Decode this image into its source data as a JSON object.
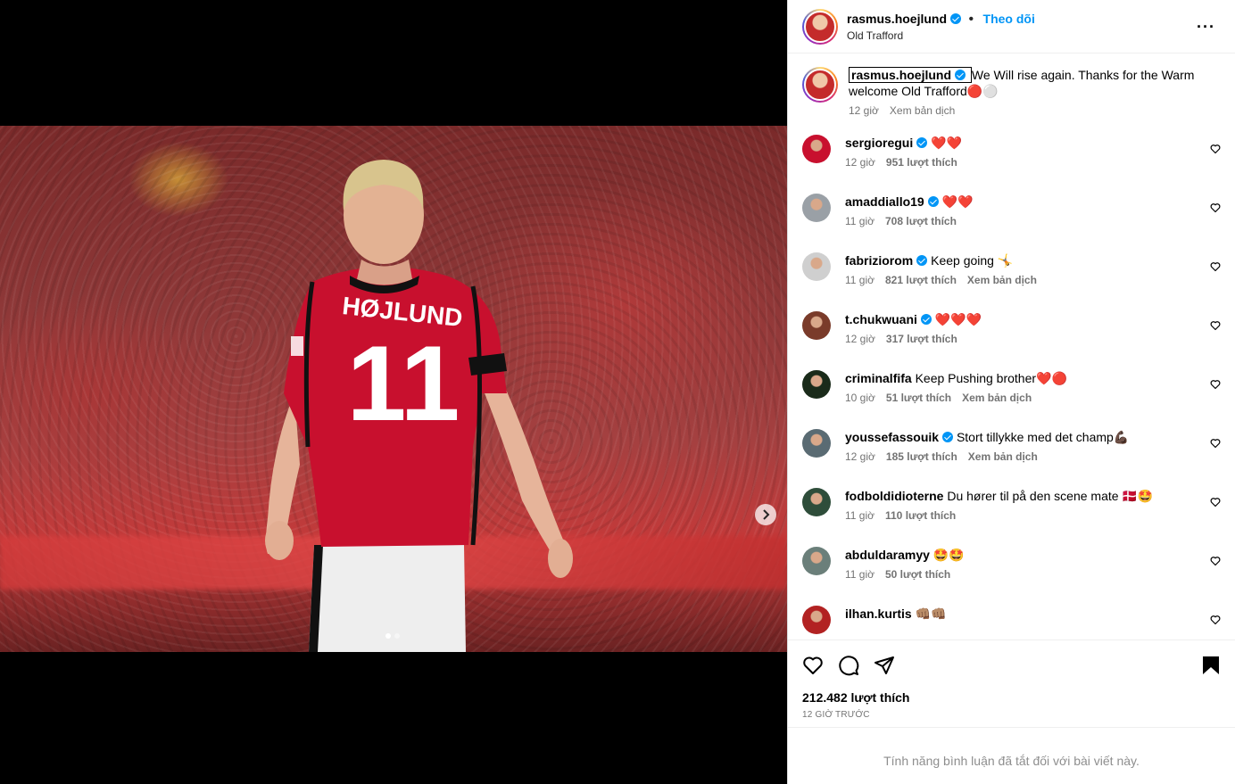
{
  "post": {
    "username": "rasmus.hoejlund",
    "follow_label": "Theo dõi",
    "location": "Old Trafford",
    "more_label": "···",
    "caption_text": "We Will rise again. Thanks for the Warm welcome Old Trafford🔴⚪",
    "caption_time": "12 giờ",
    "caption_translate": "Xem bản dịch"
  },
  "comments": [
    {
      "user": "sergioregui",
      "verified": true,
      "text": "❤️❤️",
      "time": "12 giờ",
      "likes": "951 lượt thích",
      "translate": ""
    },
    {
      "user": "amaddiallo19",
      "verified": true,
      "text": "❤️❤️",
      "time": "11 giờ",
      "likes": "708 lượt thích",
      "translate": ""
    },
    {
      "user": "fabriziorom",
      "verified": true,
      "text": "Keep going 🤸",
      "time": "11 giờ",
      "likes": "821 lượt thích",
      "translate": "Xem bản dịch"
    },
    {
      "user": "t.chukwuani",
      "verified": true,
      "text": "❤️❤️❤️",
      "time": "12 giờ",
      "likes": "317 lượt thích",
      "translate": ""
    },
    {
      "user": "criminalfifa",
      "verified": false,
      "text": "Keep Pushing brother❤️🔴",
      "time": "10 giờ",
      "likes": "51 lượt thích",
      "translate": "Xem bản dịch"
    },
    {
      "user": "youssefassouik",
      "verified": true,
      "text": "Stort tillykke med det champ💪🏿",
      "time": "12 giờ",
      "likes": "185 lượt thích",
      "translate": "Xem bản dịch"
    },
    {
      "user": "fodboldidioterne",
      "verified": false,
      "text": "Du hører til på den scene mate 🇩🇰🤩",
      "time": "11 giờ",
      "likes": "110 lượt thích",
      "translate": ""
    },
    {
      "user": "abduldaramyy",
      "verified": false,
      "text": "🤩🤩",
      "time": "11 giờ",
      "likes": "50 lượt thích",
      "translate": ""
    },
    {
      "user": "ilhan.kurtis",
      "verified": false,
      "text": "👊🏽👊🏽",
      "time": "",
      "likes": "",
      "translate": ""
    }
  ],
  "footer": {
    "likes": "212.482 lượt thích",
    "ago": "12 GIỜ TRƯỚC",
    "comments_disabled": "Tính năng bình luận đã tắt đối với bài viết này."
  },
  "jersey": {
    "name": "HØJLUND",
    "number": "11"
  },
  "colors": {
    "accent": "#0095f6",
    "jersey_red": "#c8102e",
    "heart_red": "#e0245e"
  }
}
